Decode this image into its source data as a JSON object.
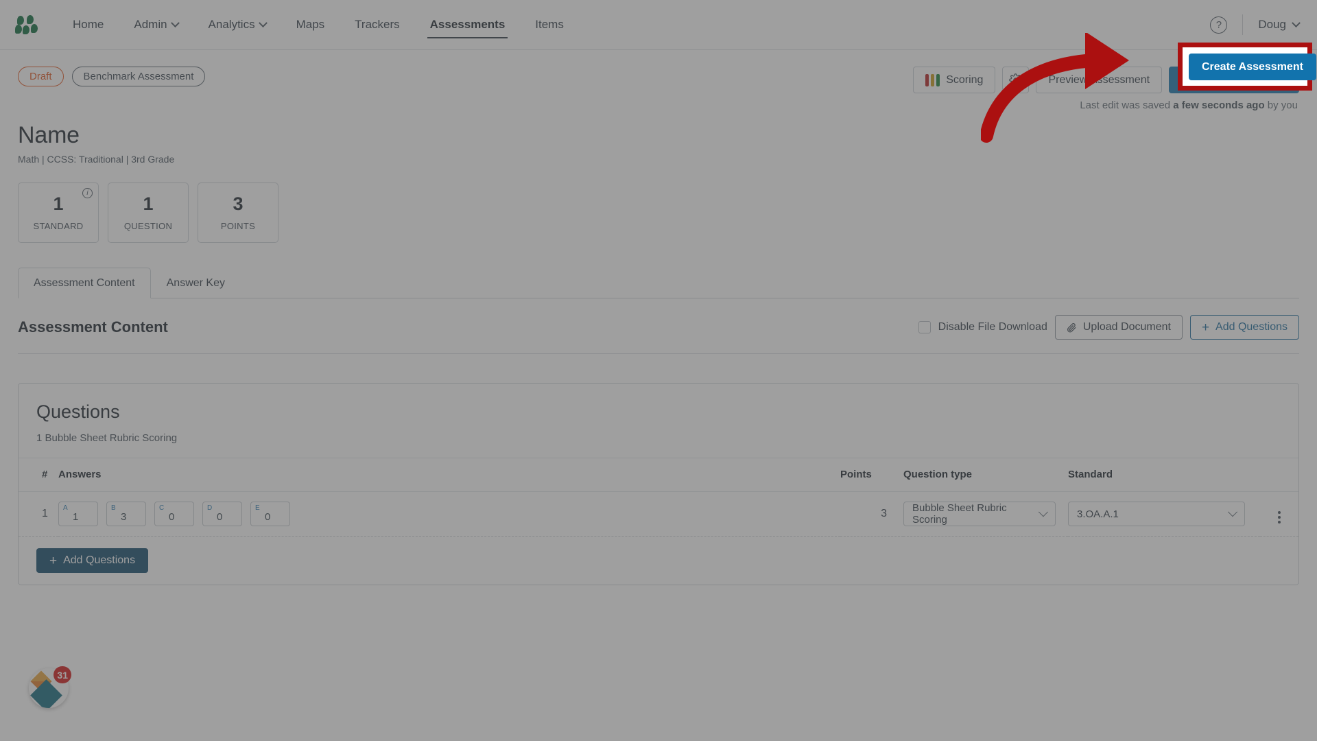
{
  "nav": {
    "logo_name": "application-logo",
    "items": [
      {
        "label": "Home",
        "has_caret": false,
        "active": false
      },
      {
        "label": "Admin",
        "has_caret": true,
        "active": false
      },
      {
        "label": "Analytics",
        "has_caret": true,
        "active": false
      },
      {
        "label": "Maps",
        "has_caret": false,
        "active": false
      },
      {
        "label": "Trackers",
        "has_caret": false,
        "active": false
      },
      {
        "label": "Assessments",
        "has_caret": false,
        "active": true
      },
      {
        "label": "Items",
        "has_caret": false,
        "active": false
      }
    ],
    "help_glyph": "?",
    "user_name": "Doug"
  },
  "header": {
    "status_pill": "Draft",
    "type_pill": "Benchmark Assessment",
    "title": "Name",
    "subtitle": "Math  |  CCSS: Traditional  |  3rd Grade",
    "scoring_button": "Scoring",
    "settings_icon": "gear-icon",
    "preview_button": "Preview Assessment",
    "create_button": "Create Assessment",
    "save_status_prefix": "Last edit was saved ",
    "save_status_emphasis": "a few seconds ago",
    "save_status_suffix": " by you"
  },
  "stats": [
    {
      "value": "1",
      "label": "STANDARD",
      "info": true
    },
    {
      "value": "1",
      "label": "QUESTION",
      "info": false
    },
    {
      "value": "3",
      "label": "POINTS",
      "info": false
    }
  ],
  "tabs": [
    {
      "label": "Assessment Content",
      "active": true
    },
    {
      "label": "Answer Key",
      "active": false
    }
  ],
  "content": {
    "section_title": "Assessment Content",
    "disable_download_label": "Disable File Download",
    "disable_download_checked": false,
    "upload_button": "Upload Document",
    "add_questions_button": "Add Questions"
  },
  "questions_card": {
    "title": "Questions",
    "subtitle": "1 Bubble Sheet Rubric Scoring",
    "columns": [
      "#",
      "Answers",
      "Points",
      "Question type",
      "Standard"
    ],
    "rows": [
      {
        "number": "1",
        "answers": [
          {
            "letter": "A",
            "value": "1"
          },
          {
            "letter": "B",
            "value": "3"
          },
          {
            "letter": "C",
            "value": "0"
          },
          {
            "letter": "D",
            "value": "0"
          },
          {
            "letter": "E",
            "value": "0"
          }
        ],
        "points": "3",
        "question_type": "Bubble Sheet Rubric Scoring",
        "standard": "3.OA.A.1"
      }
    ],
    "footer_button": "Add Questions"
  },
  "widget": {
    "badge_count": "31",
    "name": "notification-widget"
  },
  "colors": {
    "accent_blue": "#1273ad",
    "dark_blue": "#11496b",
    "draft_orange": "#e0561f",
    "highlight_red": "#ab1010",
    "logo_green": "#0c6b3d",
    "scoring_bar_red": "#b32020",
    "scoring_bar_yellow": "#c79a18",
    "scoring_bar_green": "#1a7f37"
  }
}
